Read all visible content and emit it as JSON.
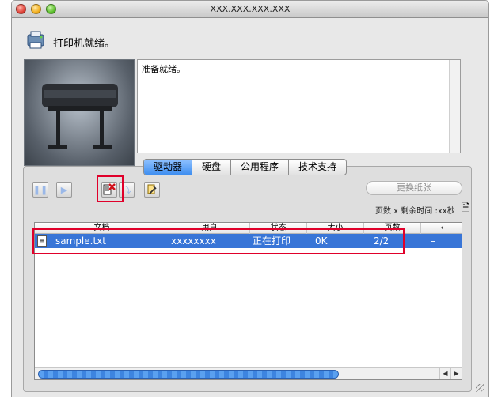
{
  "window": {
    "title": "XXX.XXX.XXX.XXX"
  },
  "status": {
    "text": "打印机就绪。",
    "message": "准备就绪。"
  },
  "tabs": [
    {
      "label": "驱动器",
      "active": true
    },
    {
      "label": "硬盘",
      "active": false
    },
    {
      "label": "公用程序",
      "active": false
    },
    {
      "label": "技术支持",
      "active": false
    }
  ],
  "toolbar": {
    "change_paper_label": "更换纸张",
    "remaining": "页数 x 剩余时间 :xx秒"
  },
  "joblist": {
    "columns": [
      "文档",
      "用户",
      "状态",
      "大小",
      "页数",
      "‹"
    ],
    "rows": [
      {
        "doc": "sample.txt",
        "user": "xxxxxxxx",
        "status": "正在打印",
        "size": "0K",
        "pages": "2/2",
        "extra": "–"
      }
    ]
  },
  "colors": {
    "selection": "#3875d7",
    "highlight": "#e0002a",
    "tab_active": "#3f8ef0"
  }
}
